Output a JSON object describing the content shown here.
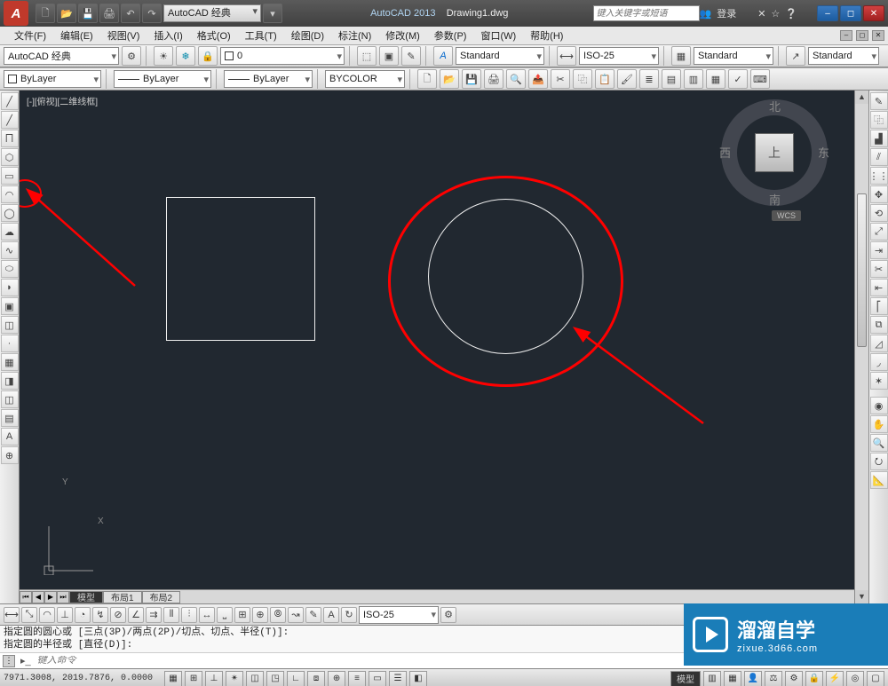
{
  "title": {
    "app": "AutoCAD 2013",
    "file": "Drawing1.dwg"
  },
  "search_placeholder": "键入关键字或短语",
  "login_label": "登录",
  "workspace_quick": "AutoCAD 经典",
  "menus": [
    "文件(F)",
    "编辑(E)",
    "视图(V)",
    "插入(I)",
    "格式(O)",
    "工具(T)",
    "绘图(D)",
    "标注(N)",
    "修改(M)",
    "参数(P)",
    "窗口(W)",
    "帮助(H)"
  ],
  "toolbars": {
    "workspace": "AutoCAD 经典",
    "layer_current": "0",
    "text_style": "Standard",
    "dim_style": "ISO-25",
    "table_style": "Standard",
    "annot_style": "Standard",
    "props_layer1": "ByLayer",
    "props_layer2": "ByLayer",
    "props_layer3": "ByLayer",
    "props_color": "BYCOLOR",
    "dim_bottom": "ISO-25"
  },
  "viewport_label": "[-][俯视][二维线框]",
  "viewcube": {
    "top": "上",
    "n": "北",
    "s": "南",
    "w": "西",
    "e": "东",
    "wcs": "WCS"
  },
  "ucs": {
    "x": "X",
    "y": "Y"
  },
  "model_tabs": {
    "model": "模型",
    "layout1": "布局1",
    "layout2": "布局2"
  },
  "command_history": "指定圆的圆心或 [三点(3P)/两点(2P)/切点、切点、半径(T)]:\n指定圆的半径或 [直径(D)]:",
  "command_placeholder": "键入命令",
  "status": {
    "coords": "7971.3008, 2019.7876, 0.0000",
    "model_pill": "模型"
  },
  "watermark": {
    "name": "溜溜自学",
    "url": "zixue.3d66.com"
  },
  "icons": {
    "new": "🗋",
    "open": "📂",
    "save": "💾",
    "print": "🖨",
    "undo": "↶",
    "redo": "↷",
    "search": "🔍",
    "people": "👥",
    "exchange": "✕",
    "help": "❔",
    "gear": "⚙",
    "star": "☆",
    "min": "–",
    "max": "◻",
    "close": "✕",
    "line": "╱",
    "pline": "⨅",
    "polygon": "⬡",
    "rect": "▭",
    "arc": "◠",
    "circle": "◯",
    "revcloud": "☁",
    "spline": "∿",
    "ellipse": "⬭",
    "block": "▣",
    "point": "·",
    "hatch": "▦",
    "region": "◫",
    "table": "▤",
    "text": "A",
    "erase": "✎",
    "copy": "⿻",
    "mirror": "▟",
    "offset": "⫽",
    "array": "⋮⋮",
    "move": "✥",
    "rotate": "⟲",
    "scale": "⤢",
    "stretch": "⇥",
    "trim": "✂",
    "extend": "⇤",
    "break": "⎡",
    "chamfer": "◿",
    "fillet": "◞",
    "explode": "✶",
    "pan": "✋",
    "zoom": "🔍",
    "orbit": "⭮",
    "wheel": "◉",
    "show": "📐",
    "home": "⌂"
  }
}
